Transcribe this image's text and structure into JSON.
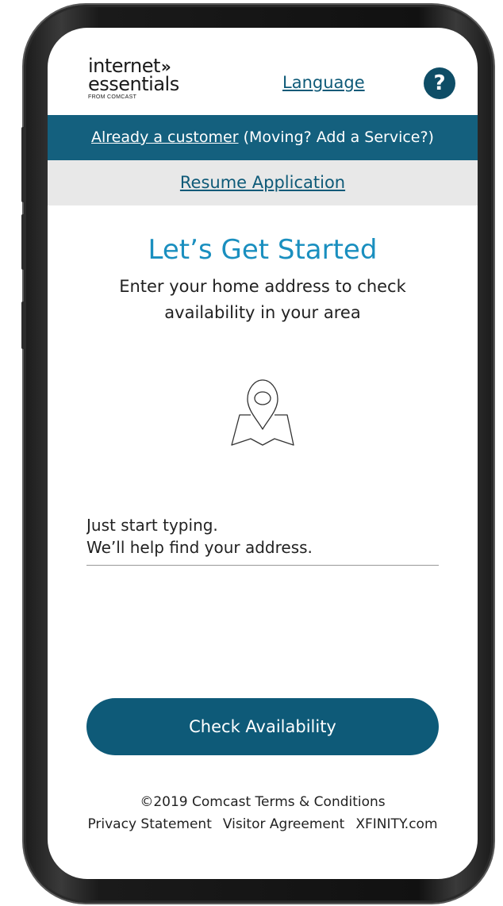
{
  "header": {
    "logo": {
      "line1": "internet",
      "chevrons": "»",
      "line2": "essentials",
      "sub": "FROM COMCAST"
    },
    "language_link": "Language",
    "help_icon": "help-icon",
    "help_glyph": "?"
  },
  "customer_bar": {
    "link_text": "Already a customer",
    "extra_text": " (Moving? Add a Service?)"
  },
  "resume_bar": {
    "link_text": "Resume Application"
  },
  "main": {
    "title": "Let’s Get Started",
    "subtitle": "Enter your home address to check availability in your area",
    "map_icon": "map-pin-icon",
    "address_input": {
      "placeholder": "Just start typing.\nWe’ll help find your address.",
      "value": ""
    },
    "check_button": "Check Availability"
  },
  "footer": {
    "copyright": "©2019 Comcast",
    "terms": "Terms & Conditions",
    "links": [
      "Privacy Statement",
      "Visitor Agreement",
      "XFINITY.com"
    ]
  },
  "colors": {
    "primary": "#0e5a78",
    "title_blue": "#1a8fbf",
    "customer_bar": "#14607e",
    "resume_bar_bg": "#e8e8e8"
  }
}
